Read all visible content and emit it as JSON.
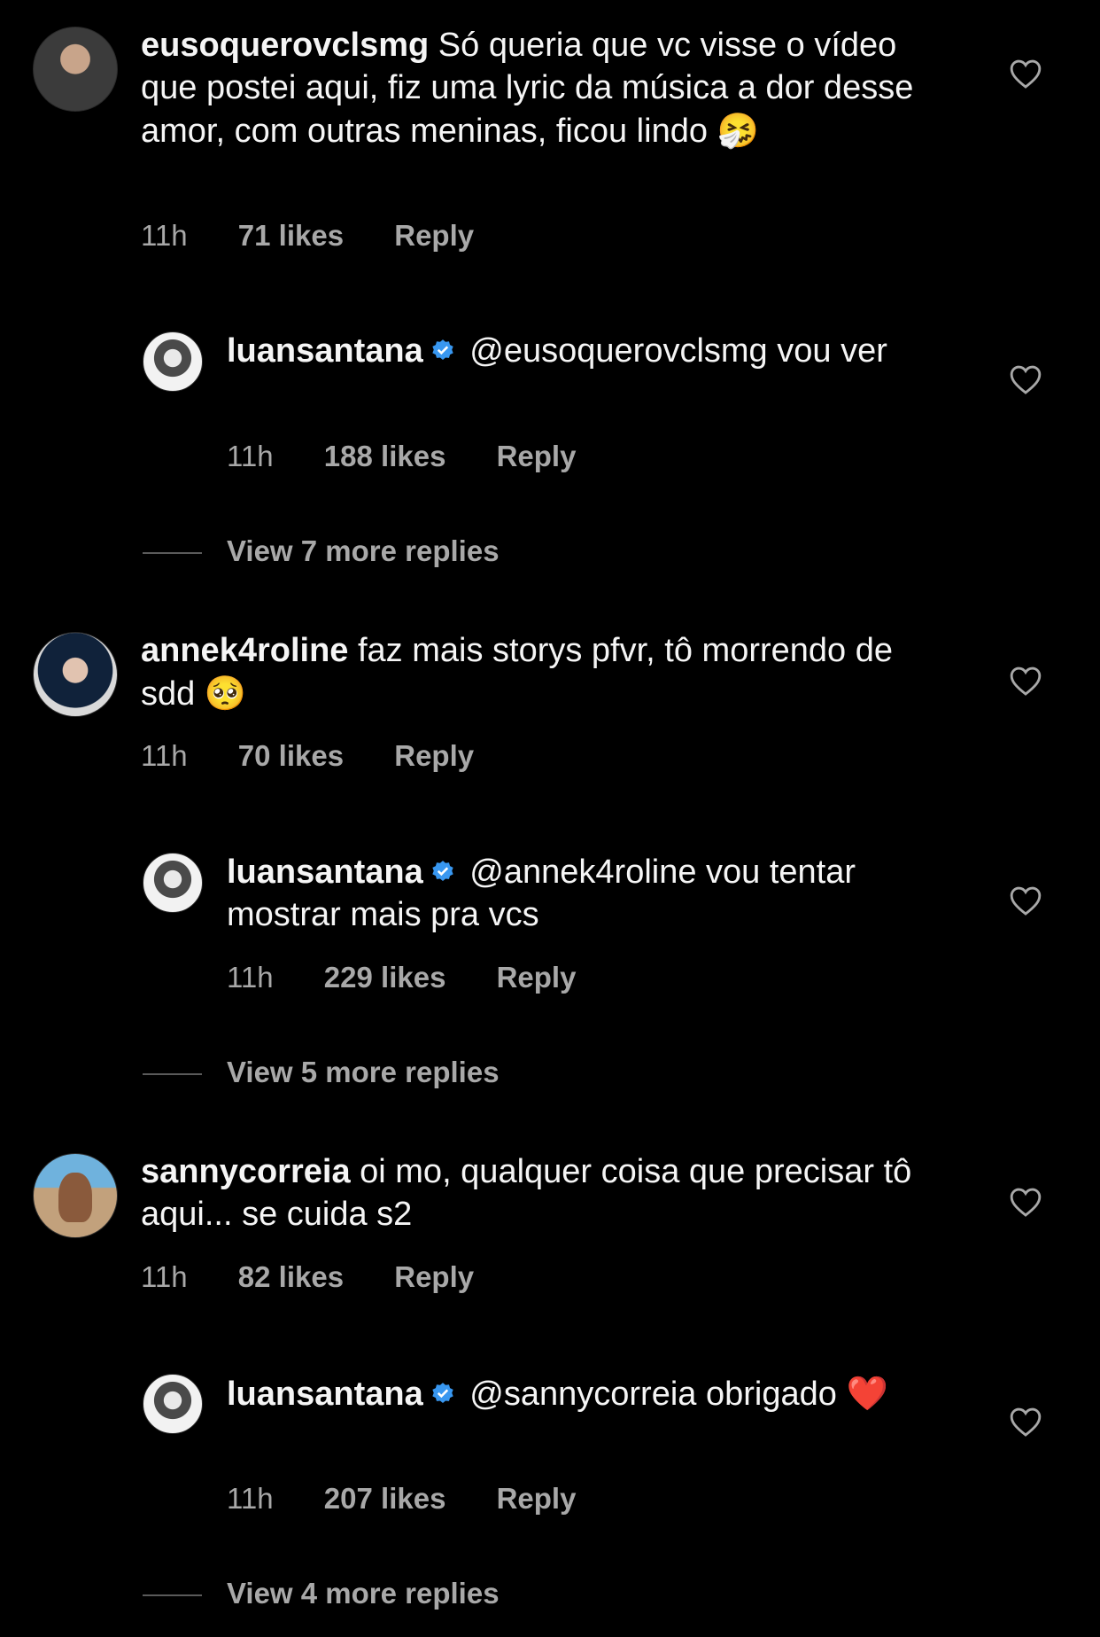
{
  "threads": [
    {
      "comment": {
        "username": "eusoquerovclsmg",
        "text": "Só queria que vc visse o vídeo que postei aqui, fiz uma lyric da música a dor desse amor, com outras meninas, ficou lindo",
        "emoji": "🤧",
        "time": "11h",
        "likes": "71 likes",
        "reply_label": "Reply"
      },
      "reply": {
        "username": "luansantana",
        "text": "@eusoquerovclsmg vou ver",
        "emoji": "",
        "time": "11h",
        "likes": "188 likes",
        "reply_label": "Reply"
      },
      "view_more": "View 7 more replies"
    },
    {
      "comment": {
        "username": "annek4roline",
        "text": "faz mais storys pfvr, tô morrendo de sdd",
        "emoji": "🥺",
        "time": "11h",
        "likes": "70 likes",
        "reply_label": "Reply"
      },
      "reply": {
        "username": "luansantana",
        "text": "@annek4roline vou tentar mostrar mais pra vcs",
        "emoji": "",
        "time": "11h",
        "likes": "229 likes",
        "reply_label": "Reply"
      },
      "view_more": "View 5 more replies"
    },
    {
      "comment": {
        "username": "sannycorreia",
        "text": "oi mo, qualquer coisa que precisar tô aqui... se cuida s2",
        "emoji": "",
        "time": "11h",
        "likes": "82 likes",
        "reply_label": "Reply"
      },
      "reply": {
        "username": "luansantana",
        "text": "@sannycorreia obrigado",
        "emoji": "❤️",
        "time": "11h",
        "likes": "207 likes",
        "reply_label": "Reply"
      },
      "view_more": "View 4 more replies"
    }
  ],
  "colors": {
    "background": "#000000",
    "text": "#f5f5f5",
    "secondary": "#a8a8a8",
    "verified": "#3897f0",
    "heart_emoji": "#e0245e"
  }
}
